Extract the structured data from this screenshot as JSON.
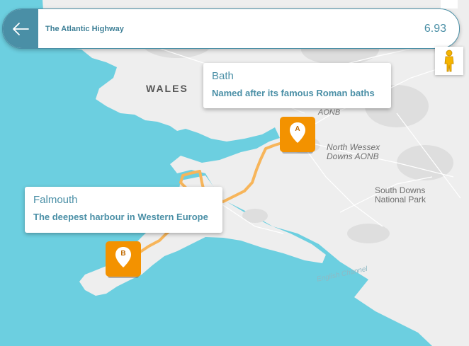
{
  "header": {
    "back_icon": "arrow-left-icon",
    "title": "The Atlantic Highway",
    "distance": "6.93"
  },
  "map": {
    "colors": {
      "water": "#6ccfe0",
      "land": "#eeeeee",
      "route": "#f7b55a",
      "accent": "#4a8fa6",
      "marker": "#f39200"
    },
    "labels": {
      "wales": "WALES",
      "aonb": "AONB",
      "north_wessex_line1": "North Wessex",
      "north_wessex_line2": "Downs AONB",
      "south_downs_line1": "South Downs",
      "south_downs_line2": "National Park",
      "english_channel": "English Channel"
    },
    "pegman_icon": "pegman-icon"
  },
  "stops": [
    {
      "marker": "A",
      "title": "Bath",
      "description": "Named after its famous Roman baths"
    },
    {
      "marker": "B",
      "title": "Falmouth",
      "description": "The deepest harbour in Western Europe"
    }
  ]
}
